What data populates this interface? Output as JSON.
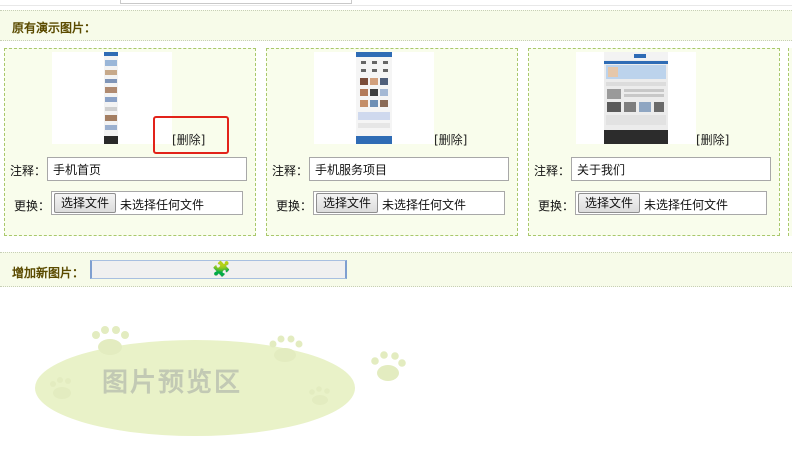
{
  "existing_section": {
    "title": "原有演示图片："
  },
  "cards": [
    {
      "delete_label": "[删除]",
      "note_label": "注释：",
      "note_value": "手机首页",
      "file_label": "更换：",
      "file_button": "选择文件",
      "file_status": "未选择任何文件"
    },
    {
      "delete_label": "[删除]",
      "note_label": "注释：",
      "note_value": "手机服务项目",
      "file_label": "更换：",
      "file_button": "选择文件",
      "file_status": "未选择任何文件"
    },
    {
      "delete_label": "[删除]",
      "note_label": "注释：",
      "note_value": "关于我们",
      "file_label": "更换：",
      "file_button": "选择文件",
      "file_status": "未选择任何文件"
    }
  ],
  "add_section": {
    "title": "增加新图片：",
    "upload_icon": "puzzle-icon"
  },
  "preview": {
    "text": "图片预览区",
    "icons": [
      "paw-print-icon"
    ]
  },
  "colors": {
    "header_bg": "#f7fbe9",
    "header_text": "#5b4b00",
    "card_bg": "#f9fdec",
    "card_border": "#a9c86c",
    "highlight": "#e2231a",
    "preview_blob": "#e9f2c8"
  }
}
